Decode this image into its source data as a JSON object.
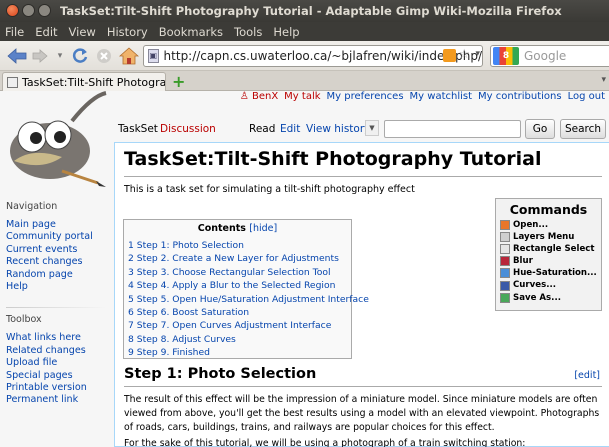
{
  "window": {
    "title": "TaskSet:Tilt-Shift Photography Tutorial - Adaptable Gimp Wiki-Mozilla Firefox"
  },
  "menu": [
    "File",
    "Edit",
    "View",
    "History",
    "Bookmarks",
    "Tools",
    "Help"
  ],
  "url": {
    "value": "http://capn.cs.uwaterloo.ca/~bjlafren/wiki/index.php/",
    "search_placeholder": "Google",
    "search_engine_label": "8"
  },
  "tab": {
    "label": "TaskSet:Tilt-Shift Photograph...",
    "new_tab": "+"
  },
  "personal": {
    "user": "BenX",
    "mytalk": "My talk",
    "prefs": "My preferences",
    "watchlist": "My watchlist",
    "contribs": "My contributions",
    "logout": "Log out"
  },
  "page_tabs": {
    "taskset": "TaskSet",
    "discussion": "Discussion",
    "read": "Read",
    "edit": "Edit",
    "history": "View history",
    "go": "Go",
    "search": "Search"
  },
  "article": {
    "title": "TaskSet:Tilt-Shift Photography Tutorial",
    "intro": "This is a task set for simulating a tilt-shift photography effect",
    "toc_title": "Contents",
    "toc_hide": "[hide]",
    "toc": [
      "1 Step 1: Photo Selection",
      "2 Step 2. Create a New Layer for Adjustments",
      "3 Step 3. Choose Rectangular Selection Tool",
      "4 Step 4. Apply a Blur to the Selected Region",
      "5 Step 5. Open Hue/Saturation Adjustment Interface",
      "6 Step 6. Boost Saturation",
      "7 Step 7. Open Curves Adjustment Interface",
      "8 Step 8. Adjust Curves",
      "9 Step 9. Finished"
    ],
    "step1": "Step 1: Photo Selection",
    "edit": "[edit]",
    "para1": "The result of this effect will be the impression of a miniature model. Since miniature models are often viewed from above, you'll get the best results using a model with an elevated viewpoint. Photographs of roads, cars, buildings, trains, and railways are popular choices for this effect.",
    "para2": "For the sake of this tutorial, we will be using a photograph of a train switching station:"
  },
  "commands": {
    "title": "Commands",
    "items": [
      {
        "label": "Open...",
        "color": "#e8762a"
      },
      {
        "label": "Layers Menu",
        "color": "#cfcfcf"
      },
      {
        "label": "Rectangle Select",
        "color": "#e6e6e6"
      },
      {
        "label": "Blur",
        "color": "#b8263a"
      },
      {
        "label": "Hue-Saturation...",
        "color": "#4a8ed8"
      },
      {
        "label": "Curves...",
        "color": "#3a5aa8"
      },
      {
        "label": "Save As...",
        "color": "#4aa85a"
      }
    ]
  },
  "sidebar": {
    "nav_heading": "Navigation",
    "nav": [
      "Main page",
      "Community portal",
      "Current events",
      "Recent changes",
      "Random page",
      "Help"
    ],
    "toolbox_heading": "Toolbox",
    "toolbox": [
      "What links here",
      "Related changes",
      "Upload file",
      "Special pages",
      "Printable version",
      "Permanent link"
    ]
  }
}
